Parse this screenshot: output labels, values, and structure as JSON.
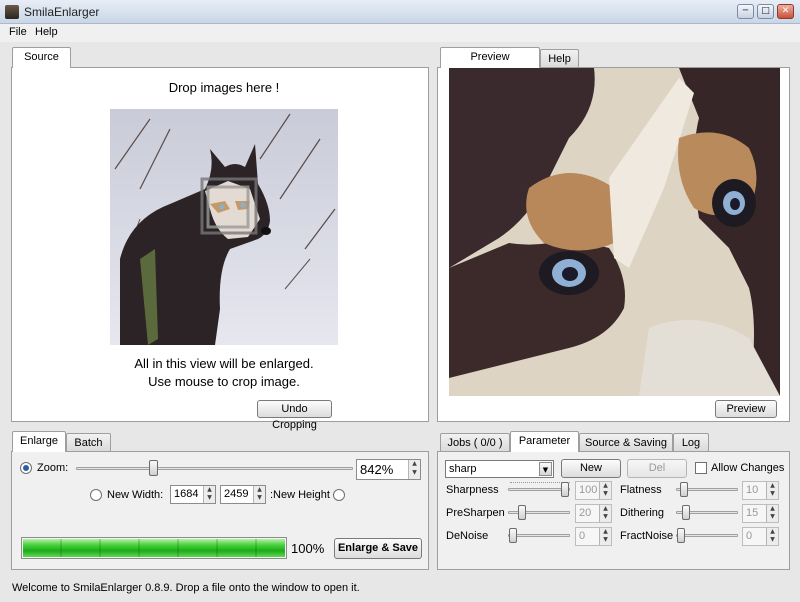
{
  "window": {
    "title": "SmilaEnlarger"
  },
  "menu": {
    "file": "File",
    "help": "Help"
  },
  "source_tab": {
    "label": "Source"
  },
  "source": {
    "drop_hint": "Drop images here !",
    "info_line1": "All in this view will be enlarged.",
    "info_line2": "Use mouse to crop image.",
    "undo_button": "Undo Cropping"
  },
  "preview_tabs": {
    "preview": "Preview",
    "help": "Help"
  },
  "preview": {
    "button": "Preview"
  },
  "enlarge_tabs": {
    "enlarge": "Enlarge",
    "batch": "Batch"
  },
  "enlarge": {
    "zoom_label": "Zoom:",
    "zoom_value": "842%",
    "new_width_label": "New Width:",
    "width_value": "1684",
    "height_value": "2459",
    "new_height_label": ":New Height",
    "progress_percent": 100,
    "progress_text": "100%",
    "enlarge_save_button": "Enlarge & Save"
  },
  "param_tabs": {
    "jobs": "Jobs ( 0/0 )",
    "parameter": "Parameter",
    "source_saving": "Source & Saving",
    "log": "Log"
  },
  "parameter": {
    "preset_value": "sharp",
    "new_button": "New",
    "del_button": "Del",
    "allow_changes_label": "Allow Changes",
    "sharpness_label": "Sharpness",
    "sharpness_value": "100",
    "presharpen_label": "PreSharpen",
    "presharpen_value": "20",
    "denoise_label": "DeNoise",
    "denoise_value": "0",
    "flatness_label": "Flatness",
    "flatness_value": "10",
    "dithering_label": "Dithering",
    "dithering_value": "15",
    "fractnoise_label": "FractNoise",
    "fractnoise_value": "0"
  },
  "status": {
    "text": "Welcome to SmilaEnlarger 0.8.9.  Drop a file onto the window to open it."
  }
}
